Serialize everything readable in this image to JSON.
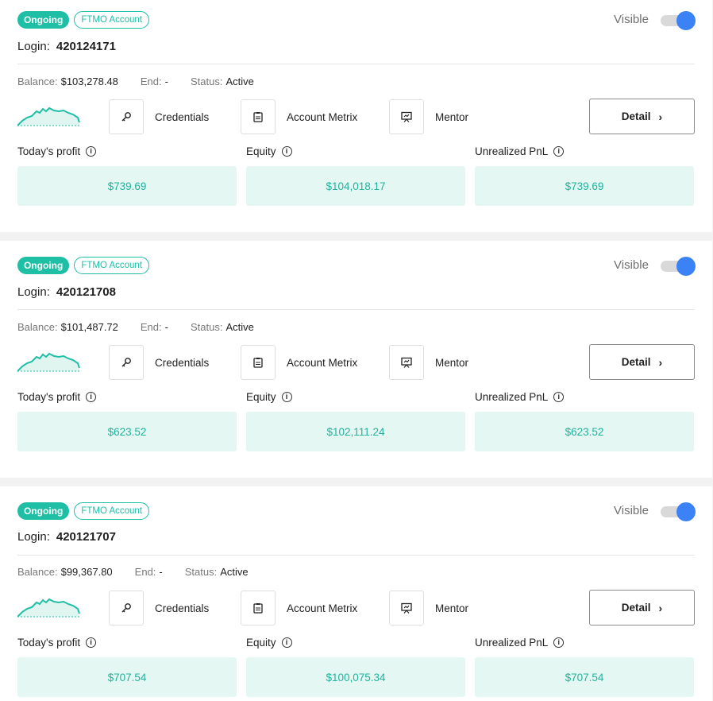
{
  "labels": {
    "status_badge": "Ongoing",
    "account_badge": "FTMO Account",
    "visible": "Visible",
    "login": "Login:",
    "balance": "Balance:",
    "end": "End:",
    "status": "Status:",
    "credentials": "Credentials",
    "account_metrix": "Account Metrix",
    "mentor": "Mentor",
    "detail": "Detail",
    "todays_profit": "Today's profit",
    "equity": "Equity",
    "unrealized_pnl": "Unrealized PnL"
  },
  "colors": {
    "accent": "#1fbfa6",
    "toggle_on": "#3b82f6",
    "stat_bg": "#e5f7f3",
    "stat_text": "#21b39b"
  },
  "icons": {
    "credentials": "key-icon",
    "account_metrix": "list-icon",
    "mentor": "presentation-icon",
    "detail": "chevron-right-icon",
    "info": "info-icon"
  },
  "accounts": [
    {
      "login": "420124171",
      "balance": "$103,278.48",
      "end": "-",
      "status": "Active",
      "visible": true,
      "todays_profit": "$739.69",
      "equity": "$104,018.17",
      "unrealized_pnl": "$739.69"
    },
    {
      "login": "420121708",
      "balance": "$101,487.72",
      "end": "-",
      "status": "Active",
      "visible": true,
      "todays_profit": "$623.52",
      "equity": "$102,111.24",
      "unrealized_pnl": "$623.52"
    },
    {
      "login": "420121707",
      "balance": "$99,367.80",
      "end": "-",
      "status": "Active",
      "visible": true,
      "todays_profit": "$707.54",
      "equity": "$100,075.34",
      "unrealized_pnl": "$707.54"
    }
  ]
}
